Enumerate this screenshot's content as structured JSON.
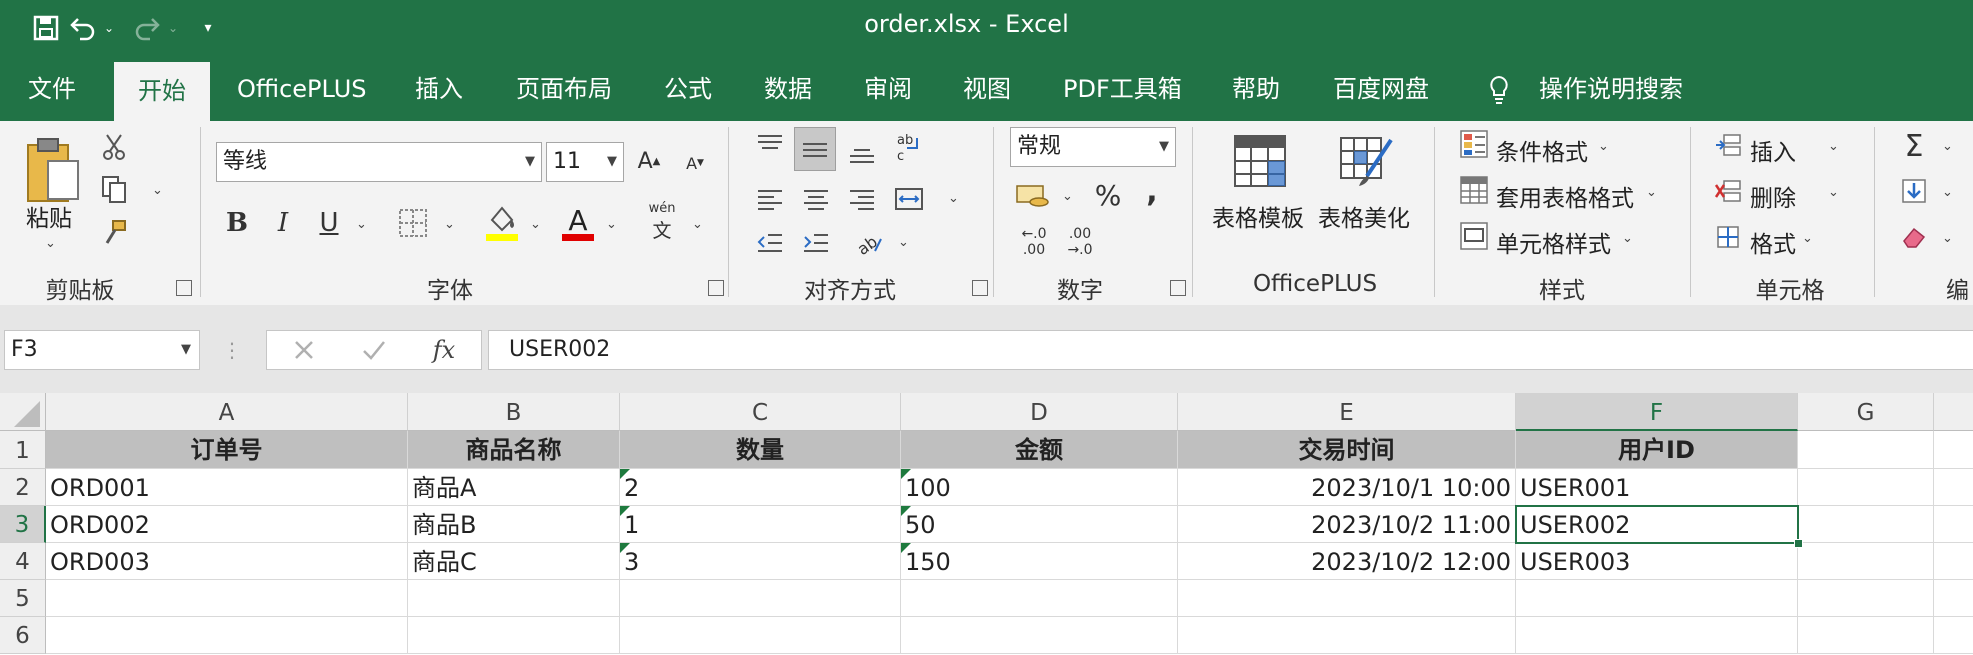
{
  "app": {
    "title": "order.xlsx  -  Excel"
  },
  "tabs": [
    {
      "label": "文件"
    },
    {
      "label": "开始"
    },
    {
      "label": "OfficePLUS"
    },
    {
      "label": "插入"
    },
    {
      "label": "页面布局"
    },
    {
      "label": "公式"
    },
    {
      "label": "数据"
    },
    {
      "label": "审阅"
    },
    {
      "label": "视图"
    },
    {
      "label": "PDF工具箱"
    },
    {
      "label": "帮助"
    },
    {
      "label": "百度网盘"
    },
    {
      "label": "操作说明搜索"
    }
  ],
  "ribbon": {
    "clipboard": {
      "paste_label": "粘贴",
      "group_label": "剪贴板"
    },
    "font": {
      "font_name": "等线",
      "font_size": "11",
      "group_label": "字体",
      "bold": "B",
      "italic": "I",
      "underline": "U",
      "phonetic_top": "wén",
      "phonetic_bottom": "文"
    },
    "alignment": {
      "group_label": "对齐方式"
    },
    "number": {
      "format": "常规",
      "group_label": "数字",
      "percent": "%",
      "comma": ",",
      "inc_decimal_top": "←.0",
      "inc_decimal_bottom": ".00",
      "dec_decimal_top": ".00",
      "dec_decimal_bottom": "→.0"
    },
    "officeplus": {
      "template_label": "表格模板",
      "beautify_label": "表格美化",
      "group_label": "OfficePLUS"
    },
    "styles": {
      "conditional": "条件格式",
      "table_format": "套用表格格式",
      "cell_style": "单元格样式",
      "group_label": "样式"
    },
    "cells": {
      "insert": "插入",
      "delete": "删除",
      "format": "格式",
      "group_label": "单元格"
    },
    "editing": {
      "group_label": "编"
    }
  },
  "formula_bar": {
    "name_box": "F3",
    "fx": "fx",
    "formula": "USER002"
  },
  "sheet": {
    "columns": [
      "A",
      "B",
      "C",
      "D",
      "E",
      "F",
      "G"
    ],
    "rows": [
      "1",
      "2",
      "3",
      "4",
      "5",
      "6"
    ],
    "header": [
      "订单号",
      "商品名称",
      "数量",
      "金额",
      "交易时间",
      "用户ID"
    ],
    "data": [
      [
        "ORD001",
        "商品A",
        "2",
        "100",
        "2023/10/1 10:00",
        "USER001"
      ],
      [
        "ORD002",
        "商品B",
        "1",
        "50",
        "2023/10/2 11:00",
        "USER002"
      ],
      [
        "ORD003",
        "商品C",
        "3",
        "150",
        "2023/10/2 12:00",
        "USER003"
      ]
    ],
    "selected_cell": "F3"
  },
  "colors": {
    "excel_green": "#217346",
    "header_fill": "#bfbfbf",
    "error_triangle": "#1e7a3e"
  }
}
